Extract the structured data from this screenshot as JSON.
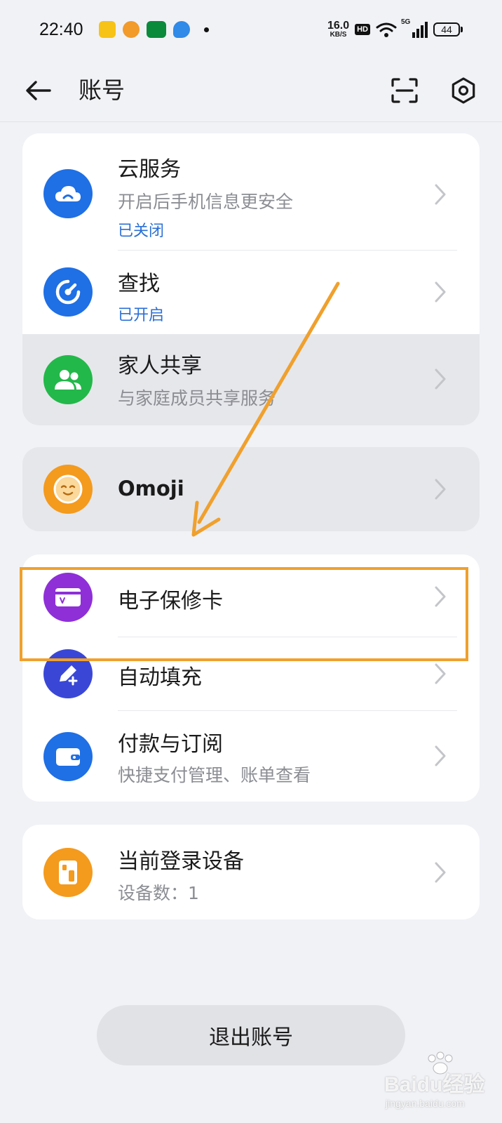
{
  "status_bar": {
    "time": "22:40",
    "net_speed_value": "16.0",
    "net_speed_unit": "KB/S",
    "hd_label": "HD",
    "network_label": "5G",
    "battery": "44"
  },
  "header": {
    "title": "账号",
    "back_icon": "arrow-left-icon",
    "scan_icon": "scan-icon",
    "settings_icon": "gear-icon"
  },
  "groups": [
    {
      "items": [
        {
          "title": "云服务",
          "subtitle": "开启后手机信息更安全",
          "status": "已关闭",
          "icon": "cloud-icon",
          "icon_color": "#1f6fe5"
        },
        {
          "title": "查找",
          "status": "已开启",
          "icon": "find-device-icon",
          "icon_color": "#1f6fe5"
        },
        {
          "title": "家人共享",
          "subtitle": "与家庭成员共享服务",
          "icon": "family-icon",
          "icon_color": "#23b84a"
        }
      ]
    },
    {
      "items": [
        {
          "title": "Omoji",
          "icon": "omoji-face-icon",
          "icon_color": "#f49a1d"
        }
      ]
    },
    {
      "items": [
        {
          "title": "电子保修卡",
          "icon": "warranty-card-icon",
          "icon_color": "#8e2fd8"
        },
        {
          "title": "自动填充",
          "icon": "autofill-pen-icon",
          "icon_color": "#3a47d6"
        },
        {
          "title": "付款与订阅",
          "subtitle": "快捷支付管理、账单查看",
          "icon": "wallet-icon",
          "icon_color": "#1f6fe5"
        }
      ]
    },
    {
      "items": [
        {
          "title": "当前登录设备",
          "subtitle": "设备数：1",
          "icon": "devices-icon",
          "icon_color": "#f49a1d"
        }
      ]
    }
  ],
  "logout_label": "退出账号",
  "watermark": {
    "text": "Baidu经验",
    "sub": "jingyan.baidu.com"
  },
  "annotation_color": "#f0a02c"
}
